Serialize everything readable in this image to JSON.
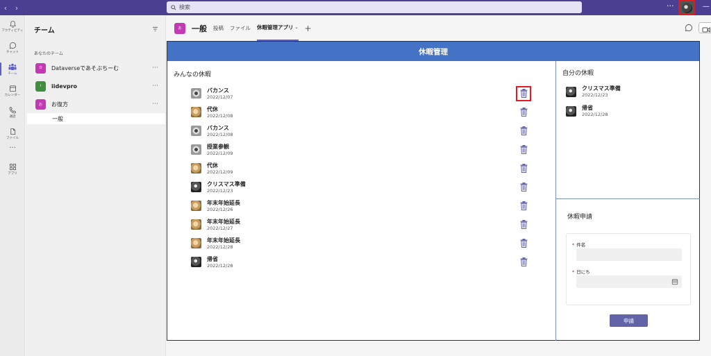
{
  "search": {
    "placeholder": "検索"
  },
  "rail": [
    {
      "label": "アクティビティ",
      "icon": "bell-icon"
    },
    {
      "label": "チャット",
      "icon": "chat-icon"
    },
    {
      "label": "チーム",
      "icon": "teams-icon"
    },
    {
      "label": "カレンダー",
      "icon": "calendar-icon"
    },
    {
      "label": "通話",
      "icon": "phone-icon"
    },
    {
      "label": "ファイル",
      "icon": "file-icon"
    },
    {
      "label": "アプリ",
      "icon": "apps-icon"
    }
  ],
  "teams_panel": {
    "title": "チーム",
    "section": "あなたのチーム",
    "teams": [
      {
        "name": "Dataverseであそぶちーむ",
        "logo": "D",
        "color": "#c239b3"
      },
      {
        "name": "iidevpro",
        "logo": "i",
        "color": "#3f8f3f"
      },
      {
        "name": "お復方",
        "logo": "お",
        "color": "#c239b3"
      }
    ],
    "channel": "一般"
  },
  "channel_header": {
    "logo": "お",
    "name": "一般",
    "tabs": [
      "投稿",
      "ファイル",
      "休暇管理アプリ"
    ],
    "active_tab": 2
  },
  "app": {
    "title": "休暇管理",
    "all_title": "みんなの休暇",
    "mine_title": "自分の休暇",
    "form_title": "休暇申請",
    "all_vacations": [
      {
        "title": "バカンス",
        "date": "2022/12/07",
        "pic": "cam"
      },
      {
        "title": "代休",
        "date": "2022/12/08",
        "pic": "dog"
      },
      {
        "title": "バカンス",
        "date": "2022/12/08",
        "pic": "cam"
      },
      {
        "title": "授業参観",
        "date": "2022/12/09",
        "pic": "cam"
      },
      {
        "title": "代休",
        "date": "2022/12/09",
        "pic": "dog"
      },
      {
        "title": "クリスマス準備",
        "date": "2022/12/23",
        "pic": "bw"
      },
      {
        "title": "年末年始延長",
        "date": "2022/12/26",
        "pic": "dog"
      },
      {
        "title": "年末年始延長",
        "date": "2022/12/27",
        "pic": "dog"
      },
      {
        "title": "年末年始延長",
        "date": "2022/12/28",
        "pic": "dog"
      },
      {
        "title": "帰省",
        "date": "2022/12/28",
        "pic": "bw"
      }
    ],
    "my_vacations": [
      {
        "title": "クリスマス準備",
        "date": "2022/12/23",
        "pic": "bw"
      },
      {
        "title": "帰省",
        "date": "2022/12/28",
        "pic": "bw"
      }
    ],
    "form": {
      "subject_label": "件名",
      "date_label": "日にち",
      "required_mark": "*",
      "submit_label": "申請"
    }
  }
}
